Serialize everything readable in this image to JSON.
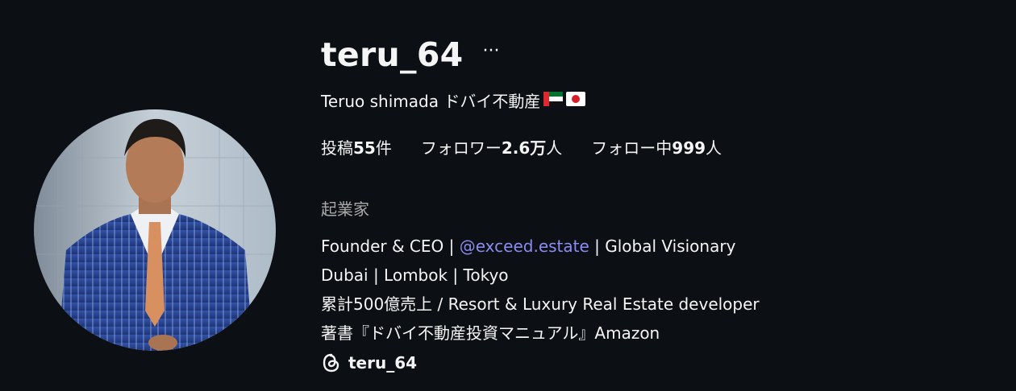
{
  "profile": {
    "username": "teru_64",
    "more_icon": "···",
    "display_name": "Teruo shimada ドバイ不動産",
    "flags": [
      "uae-flag",
      "japan-flag"
    ],
    "stats": {
      "posts_label": "投稿",
      "posts_value": "55",
      "posts_unit": "件",
      "followers_label": "フォロワー",
      "followers_value": "2.6万",
      "followers_unit": "人",
      "following_label": "フォロー中",
      "following_value": "999",
      "following_unit": "人"
    },
    "category": "起業家",
    "bio": {
      "line1_prefix": "Founder & CEO | ",
      "line1_mention": "@exceed.estate",
      "line1_suffix": " | Global Visionary",
      "line2": "Dubai | Lombok | Tokyo",
      "line3": "累計500億売上 / Resort & Luxury Real Estate developer",
      "line4": "著書『ドバイ不動産投資マニュアル』Amazon"
    },
    "threads_handle": "teru_64",
    "colors": {
      "background": "#0c0f14",
      "text": "#f5f5f5",
      "muted": "#a8a8a8",
      "link": "#8a8cf0"
    }
  }
}
